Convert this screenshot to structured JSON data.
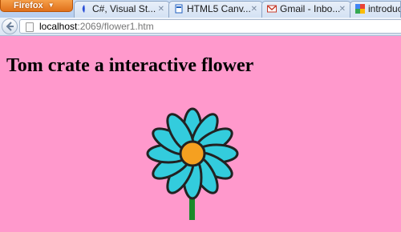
{
  "browser": {
    "menu_button": "Firefox",
    "tabs": [
      {
        "label": "C#, Visual St...",
        "icon": "visual-studio-icon"
      },
      {
        "label": "HTML5 Canv...",
        "icon": "page-icon"
      },
      {
        "label": "Gmail - Inbo...",
        "icon": "gmail-icon"
      },
      {
        "label": "introduc",
        "icon": "google-icon"
      }
    ],
    "url_host": "localhost",
    "url_rest": ":2069/flower1.htm"
  },
  "page": {
    "title": "Tom crate a interactive flower",
    "background_color": "#ff99cc"
  },
  "flower": {
    "petal_count": 12,
    "petal_color": "#33ccdd",
    "center_color": "#f5a020",
    "outline_color": "#222222",
    "stem_color": "#1a8a2a"
  }
}
